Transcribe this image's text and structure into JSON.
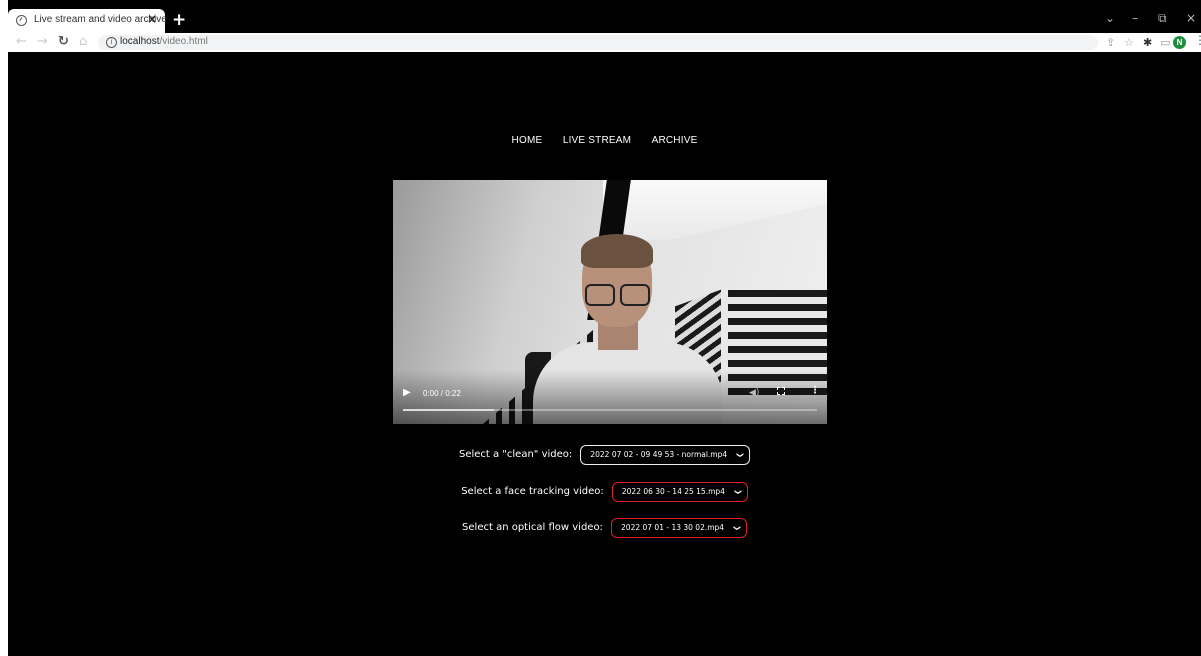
{
  "browser": {
    "tab_title": "Live stream and video archive",
    "tab_close": "×",
    "new_tab": "+",
    "url_host": "localhost",
    "url_path": "/video.html",
    "avatar_initial": "N",
    "window_controls": [
      "⌄",
      "–",
      "⧉",
      "×"
    ]
  },
  "nav": {
    "items": [
      "HOME",
      "LIVE STREAM",
      "ARCHIVE"
    ]
  },
  "video": {
    "time": "0:00 / 0:22",
    "progress": 0.22
  },
  "selects": [
    {
      "label": "Select a \"clean\" video:",
      "value": "2022 07 02 - 09 49 53 - normal.mp4",
      "style": "white"
    },
    {
      "label": "Select a face tracking video:",
      "value": "2022 06 30 - 14 25 15.mp4",
      "style": "red"
    },
    {
      "label": "Select an optical flow video:",
      "value": "2022 07 01 - 13 30 02.mp4",
      "style": "red"
    }
  ],
  "colors": {
    "background": "#000000",
    "select_border_active": "#eeeeee",
    "select_border_error": "#dd2222",
    "avatar": "#1e8e3e"
  }
}
